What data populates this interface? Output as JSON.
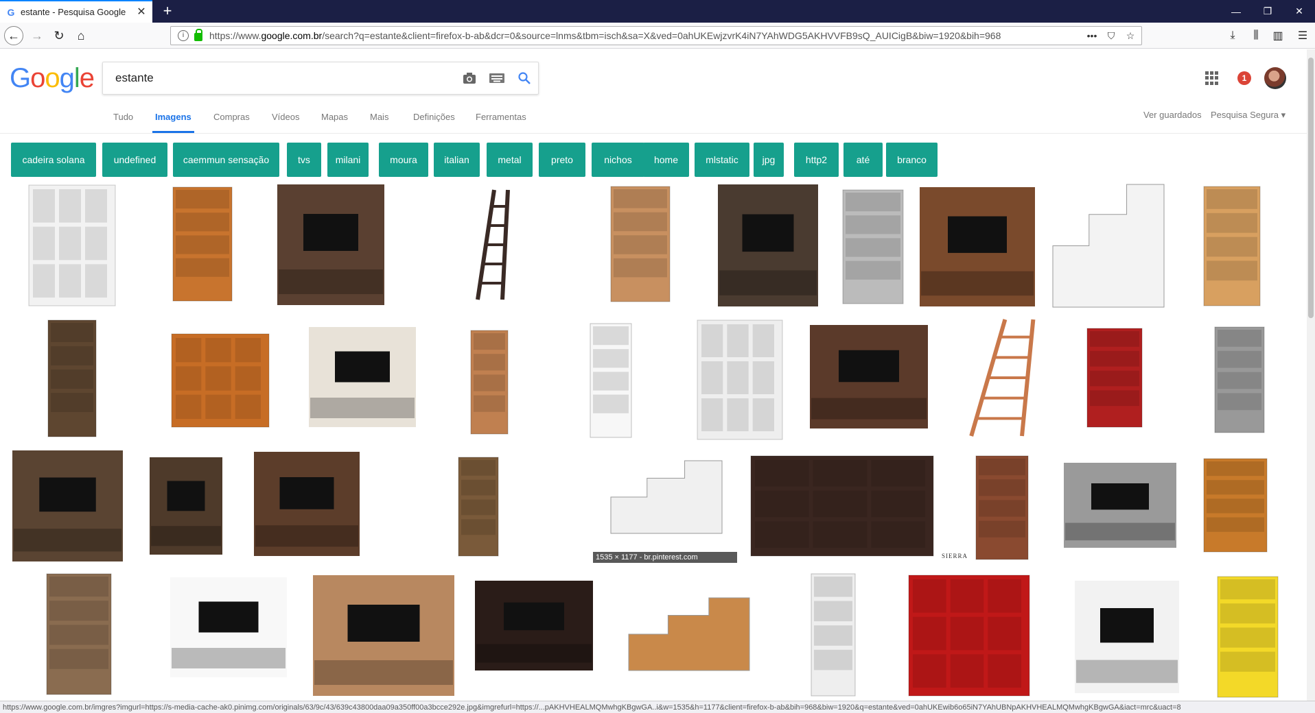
{
  "browser": {
    "tab_title": "estante - Pesquisa Google",
    "tab_favicon": "G",
    "url_host_prefix": "https://www.",
    "url_host": "google.com.br",
    "url_path": "/search?q=estante&client=firefox-b-ab&dcr=0&source=lnms&tbm=isch&sa=X&ved=0ahUKEwjzvrK4iN7YAhWDG5AKHVVFB9sQ_AUICigB&biw=1920&bih=968",
    "status_url": "https://www.google.com.br/imgres?imgurl=https://s-media-cache-ak0.pinimg.com/originals/63/9c/43/639c43800daa09a350ff00a3bcce292e.jpg&imgrefurl=https://...pAKHVHEALMQMwhgKBgwGA..i&w=1535&h=1177&client=firefox-b-ab&bih=968&biw=1920&q=estante&ved=0ahUKEwib6o65iN7YAhUBNpAKHVHEALMQMwhgKBgwGA&iact=mrc&uact=8"
  },
  "google": {
    "logo_letters": [
      "G",
      "o",
      "o",
      "g",
      "l",
      "e"
    ],
    "logo_colors": [
      "#4285f4",
      "#ea4335",
      "#fbbc05",
      "#4285f4",
      "#34a853",
      "#ea4335"
    ],
    "search_value": "estante",
    "notifications": "1",
    "tabs": [
      "Tudo",
      "Imagens",
      "Compras",
      "Vídeos",
      "Mapas",
      "Mais",
      "Definições",
      "Ferramentas"
    ],
    "active_tab": "Imagens",
    "saved_link": "Ver guardados",
    "safe_search": "Pesquisa Segura ▾",
    "chips": [
      "cadeira solana",
      "undefined",
      "caemmun sensação",
      "tvs",
      "milani",
      "moura",
      "italian",
      "metal",
      "preto",
      "nichos",
      "home",
      "mlstatic",
      "jpg",
      "http2",
      "até",
      "branco"
    ],
    "chip_color": "#16a08d",
    "hover_size_label": "1535 × 1177 - br.pinterest.com",
    "brand_text": "SIERRA"
  }
}
